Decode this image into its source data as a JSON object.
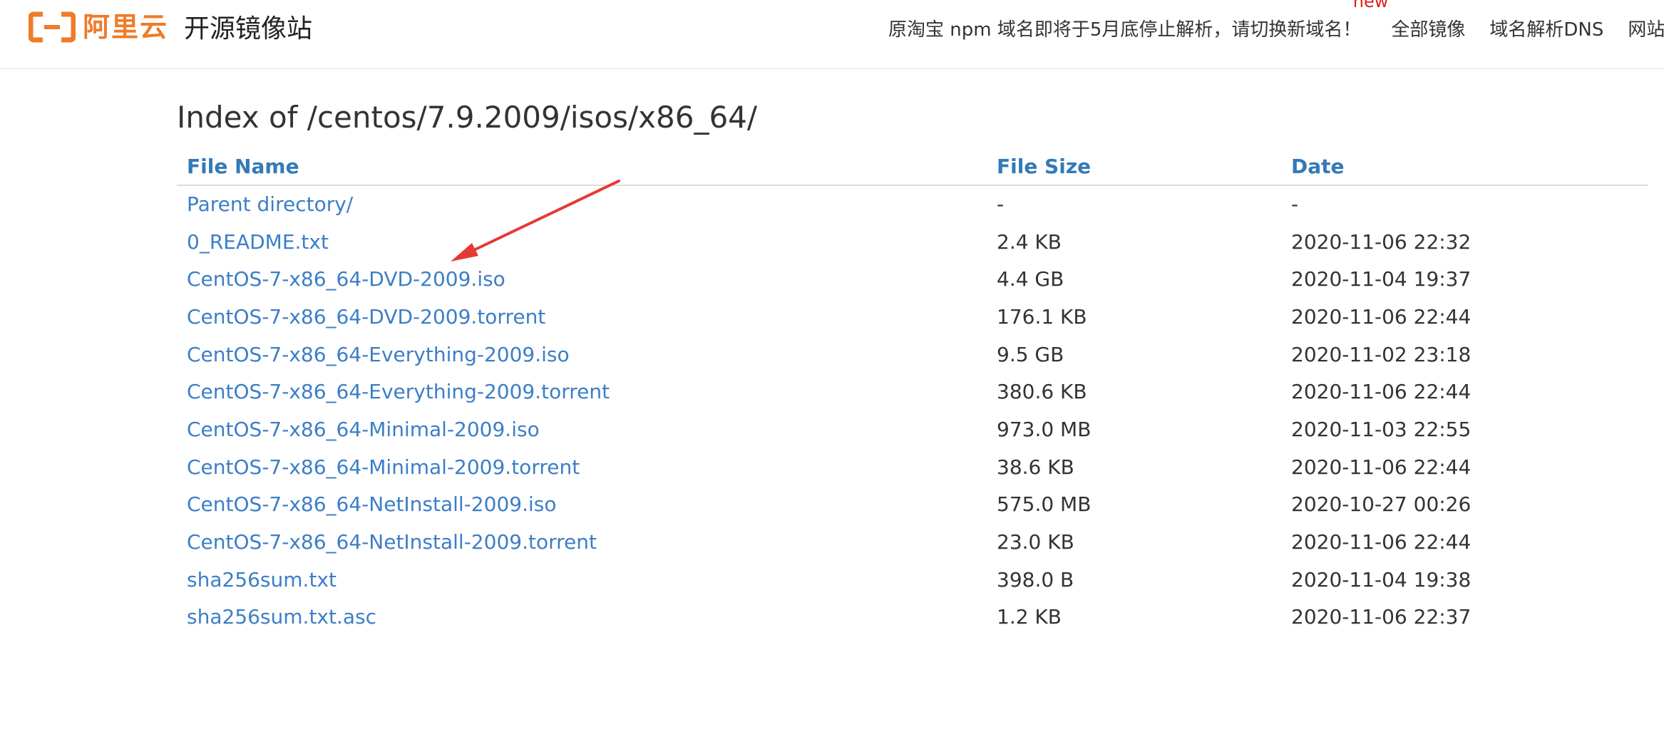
{
  "header": {
    "logo_text": "阿里云",
    "logo_icon": "aliyun-logo-icon",
    "site_title": "开源镜像站",
    "brand_color": "#f07b28",
    "nav": [
      {
        "label": "原淘宝 npm 域名即将于5月底停止解析，请切换新域名！",
        "badge": "new"
      },
      {
        "label": "全部镜像"
      },
      {
        "label": "域名解析DNS"
      },
      {
        "label": "网站授时NT"
      }
    ]
  },
  "main": {
    "title": "Index of /centos/7.9.2009/isos/x86_64/",
    "columns": [
      "File Name",
      "File Size",
      "Date"
    ],
    "rows": [
      {
        "name": "Parent directory/",
        "size": "-",
        "date": "-"
      },
      {
        "name": "0_README.txt",
        "size": "2.4 KB",
        "date": "2020-11-06 22:32"
      },
      {
        "name": "CentOS-7-x86_64-DVD-2009.iso",
        "size": "4.4 GB",
        "date": "2020-11-04 19:37"
      },
      {
        "name": "CentOS-7-x86_64-DVD-2009.torrent",
        "size": "176.1 KB",
        "date": "2020-11-06 22:44"
      },
      {
        "name": "CentOS-7-x86_64-Everything-2009.iso",
        "size": "9.5 GB",
        "date": "2020-11-02 23:18"
      },
      {
        "name": "CentOS-7-x86_64-Everything-2009.torrent",
        "size": "380.6 KB",
        "date": "2020-11-06 22:44"
      },
      {
        "name": "CentOS-7-x86_64-Minimal-2009.iso",
        "size": "973.0 MB",
        "date": "2020-11-03 22:55"
      },
      {
        "name": "CentOS-7-x86_64-Minimal-2009.torrent",
        "size": "38.6 KB",
        "date": "2020-11-06 22:44"
      },
      {
        "name": "CentOS-7-x86_64-NetInstall-2009.iso",
        "size": "575.0 MB",
        "date": "2020-10-27 00:26"
      },
      {
        "name": "CentOS-7-x86_64-NetInstall-2009.torrent",
        "size": "23.0 KB",
        "date": "2020-11-06 22:44"
      },
      {
        "name": "sha256sum.txt",
        "size": "398.0 B",
        "date": "2020-11-04 19:38"
      },
      {
        "name": "sha256sum.txt.asc",
        "size": "1.2 KB",
        "date": "2020-11-06 22:37"
      }
    ],
    "link_color": "#3c7ec7",
    "header_color": "#337ab7"
  },
  "annotation": {
    "arrow_color": "#e53935",
    "arrow_icon": "red-arrow-annotation"
  }
}
